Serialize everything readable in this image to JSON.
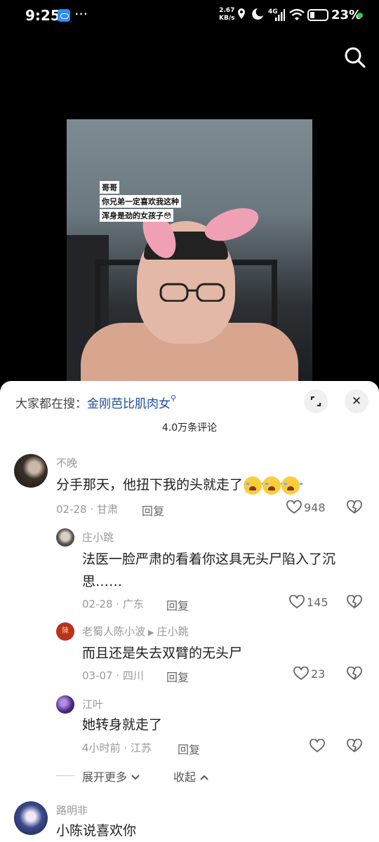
{
  "status_bar": {
    "time": "9:25",
    "net_speed_value": "2.67",
    "net_speed_unit": "KB/s",
    "network": "4G",
    "battery": "23%"
  },
  "video": {
    "captions": [
      "哥哥",
      "你兄弟一定喜欢我这种",
      "浑身是劲的女孩子😳"
    ]
  },
  "comments_panel": {
    "trending_prefix": "大家都在搜：",
    "trending_term": "金刚芭比肌肉女",
    "comment_count": "4.0万条评论",
    "expand_more": "展开更多",
    "collapse": "收起",
    "reply_label": "回复"
  },
  "comments": [
    {
      "author": "不晚",
      "text": "分手那天，他扭下我的头就走了",
      "emoji_count": 3,
      "date": "02-28",
      "location": "甘肃",
      "likes": "948"
    },
    {
      "author": "庄小跳",
      "text": "法医一脸严肃的看着你这具无头尸陷入了沉思……",
      "date": "02-28",
      "location": "广东",
      "likes": "145"
    },
    {
      "author": "老蜀人陈小波",
      "reply_to": "庄小跳",
      "text": "而且还是失去双臂的无头尸",
      "date": "03-07",
      "location": "四川",
      "likes": "23"
    },
    {
      "author": "江叶",
      "text": "她转身就走了",
      "date": "4小时前",
      "location": "江苏",
      "likes": ""
    },
    {
      "author": "路明非",
      "text": "小陈说喜欢你"
    }
  ],
  "colors": {
    "link_blue": "#1a4fa0",
    "meta_gray": "#999999",
    "sheet_bg": "#ffffff"
  }
}
